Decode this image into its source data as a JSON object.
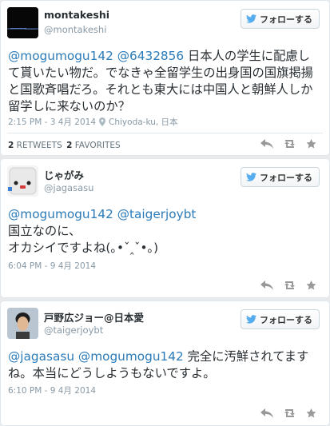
{
  "follow_label": "フォローする",
  "colors": {
    "link": "#2b7bb9",
    "muted": "#8899a6",
    "action_icon": "#999999",
    "bird": "#55acee"
  },
  "tweets": [
    {
      "display_name": "montakeshi",
      "handle": "@montakeshi",
      "mentions": [
        "@mogumogu142",
        "@6432856"
      ],
      "text": "日本人の学生に配慮して貰いたい物だ。でなきゃ全留学生の出身国の国旗掲揚と国歌斉唱だろ。それとも東大には中国人と朝鮮人しか留学しに来ないのか？",
      "timestamp": "2:15 PM - 3 4月 2014",
      "location": "Chiyoda-ku, 日本",
      "retweets_count": "2",
      "retweets_label": "RETWEETS",
      "favorites_count": "2",
      "favorites_label": "FAVORITES"
    },
    {
      "display_name": "じゃがみ",
      "handle": "@jagasasu",
      "mentions": [
        "@mogumogu142",
        "@taigerjoybt"
      ],
      "text_line1": "国立なのに、",
      "text_line2": "オカシイですよね(｡•ˇ‸ˇ•｡)",
      "timestamp": "6:04 PM - 9 4月 2014"
    },
    {
      "display_name": "戸野広ジョー@日本愛",
      "handle": "@taigerjoybt",
      "mentions": [
        "@jagasasu",
        "@mogumogu142"
      ],
      "text": "完全に汚鮮されてますね。本当にどうしようもないですよ。",
      "timestamp": "6:10 PM - 9 4月 2014"
    }
  ]
}
